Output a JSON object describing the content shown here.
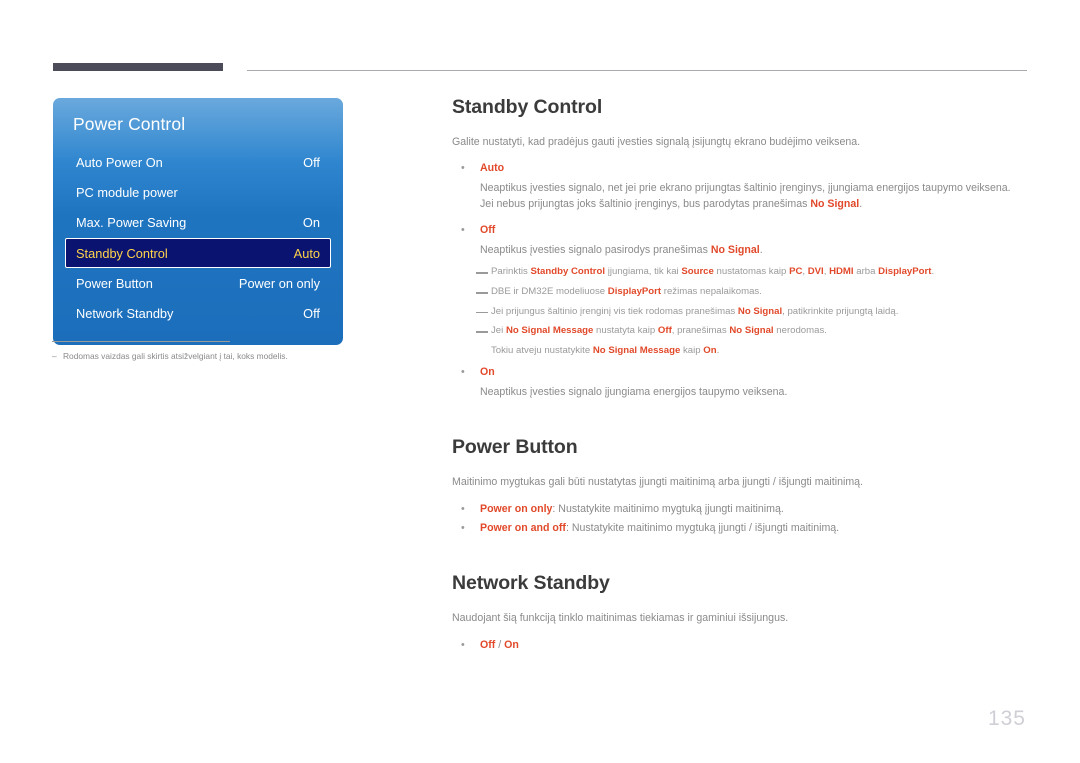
{
  "colors": {
    "accent": "#e1492a",
    "body_text": "#8a8a8a",
    "heading": "#3b3b3b",
    "panel_blue": "#1f74c0",
    "panel_selected_bg": "#0a1470",
    "panel_selected_text": "#ffd24a",
    "rule_dark": "#4b4b5a",
    "page_number": "#cfcfd6"
  },
  "osd": {
    "title": "Power Control",
    "rows": [
      {
        "label": "Auto Power On",
        "value": "Off",
        "selected": false
      },
      {
        "label": "PC module power",
        "value": "",
        "selected": false
      },
      {
        "label": "Max. Power Saving",
        "value": "On",
        "selected": false
      },
      {
        "label": "Standby Control",
        "value": "Auto",
        "selected": true
      },
      {
        "label": "Power Button",
        "value": "Power on only",
        "selected": false
      },
      {
        "label": "Network Standby",
        "value": "Off",
        "selected": false
      }
    ]
  },
  "caption": {
    "dash": "–",
    "text": "Rodomas vaizdas gali skirtis atsižvelgiant į tai, koks modelis."
  },
  "sections": {
    "standby_control": {
      "title": "Standby Control",
      "intro": "Galite nustatyti, kad pradėjus gauti įvesties signalą įsijungtų ekrano budėjimo veiksena.",
      "bullet_dot": "•",
      "auto": {
        "label": "Auto",
        "line1": "Neaptikus įvesties signalo, net jei prie ekrano prijungtas šaltinio įrenginys, įjungiama energijos taupymo veiksena.",
        "line2_pre": "Jei nebus prijungtas joks šaltinio įrenginys, bus parodytas pranešimas ",
        "line2_accent": "No Signal",
        "line2_post": "."
      },
      "off": {
        "label": "Off",
        "line1_pre": "Neaptikus įvesties signalo pasirodys pranešimas ",
        "line1_accent": "No Signal",
        "line1_post": "."
      },
      "notes": [
        {
          "parts": [
            {
              "text": "Parinktis ",
              "accent": false
            },
            {
              "text": "Standby Control",
              "accent": true
            },
            {
              "text": " įjungiama, tik kai ",
              "accent": false
            },
            {
              "text": "Source",
              "accent": true
            },
            {
              "text": " nustatomas kaip ",
              "accent": false
            },
            {
              "text": "PC",
              "accent": true
            },
            {
              "text": ", ",
              "accent": false
            },
            {
              "text": "DVI",
              "accent": true
            },
            {
              "text": ", ",
              "accent": false
            },
            {
              "text": "HDMI",
              "accent": true
            },
            {
              "text": " arba ",
              "accent": false
            },
            {
              "text": "DisplayPort",
              "accent": true
            },
            {
              "text": ".",
              "accent": false
            }
          ]
        },
        {
          "parts": [
            {
              "text": "DBE ir DM32E modeliuose ",
              "accent": false
            },
            {
              "text": "DisplayPort",
              "accent": true
            },
            {
              "text": " režimas nepalaikomas.",
              "accent": false
            }
          ]
        },
        {
          "parts": [
            {
              "text": "Jei prijungus šaltinio įrenginį vis tiek rodomas pranešimas ",
              "accent": false
            },
            {
              "text": "No Signal",
              "accent": true
            },
            {
              "text": ", patikrinkite prijungtą laidą.",
              "accent": false
            }
          ]
        },
        {
          "parts": [
            {
              "text": "Jei ",
              "accent": false
            },
            {
              "text": "No Signal Message",
              "accent": true
            },
            {
              "text": " nustatyta kaip ",
              "accent": false
            },
            {
              "text": "Off",
              "accent": true
            },
            {
              "text": ", pranešimas ",
              "accent": false
            },
            {
              "text": "No Signal",
              "accent": true
            },
            {
              "text": " nerodomas.",
              "accent": false
            }
          ],
          "continuation": [
            {
              "text": "Tokiu atveju nustatykite ",
              "accent": false
            },
            {
              "text": "No Signal Message",
              "accent": true
            },
            {
              "text": " kaip ",
              "accent": false
            },
            {
              "text": "On",
              "accent": true
            },
            {
              "text": ".",
              "accent": false
            }
          ]
        }
      ],
      "on": {
        "label": "On",
        "line1": "Neaptikus įvesties signalo įjungiama energijos taupymo veiksena."
      }
    },
    "power_button": {
      "title": "Power Button",
      "intro": "Maitinimo mygtukas gali būti nustatytas įjungti maitinimą arba įjungti / išjungti maitinimą.",
      "items": [
        {
          "label": "Power on only",
          "rest": ": Nustatykite maitinimo mygtuką įjungti maitinimą."
        },
        {
          "label": "Power on and off",
          "rest": ": Nustatykite maitinimo mygtuką įjungti / išjungti maitinimą."
        }
      ]
    },
    "network_standby": {
      "title": "Network Standby",
      "intro": "Naudojant šią funkciją tinklo maitinimas tiekiamas ir gaminiui išsijungus.",
      "options": {
        "first": "Off",
        "separator": " / ",
        "second": "On"
      }
    }
  },
  "footer": {
    "page_number": "135"
  }
}
